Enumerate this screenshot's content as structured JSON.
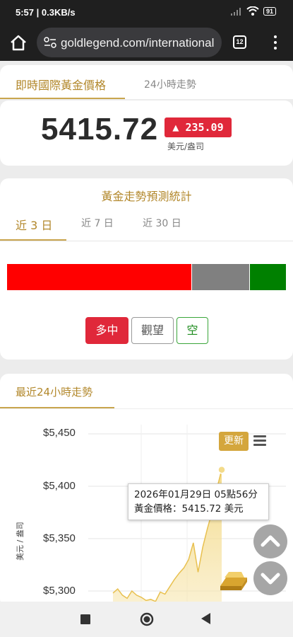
{
  "status": {
    "time": "5:57",
    "speed": "0.3KB/s",
    "battery": "91"
  },
  "browser": {
    "url": "goldlegend.com/international",
    "tab_count": "12"
  },
  "price_card": {
    "tab_live": "即時國際黃金價格",
    "tab_24h": "24小時走勢",
    "price": "5415.72",
    "change": "235.09",
    "change_direction": "up",
    "unit": "美元/盎司",
    "up_color": "#e0283a"
  },
  "forecast": {
    "title": "黃金走勢預測統計",
    "tabs": [
      "近 3 日",
      "近 7 日",
      "近 30 日"
    ],
    "active_tab": "近 3 日",
    "distribution": [
      {
        "label": "多中",
        "share": 0.66,
        "color": "#ff0000"
      },
      {
        "label": "觀望",
        "share": 0.205,
        "color": "#808080"
      },
      {
        "label": "空",
        "share": 0.135,
        "color": "#008000"
      }
    ],
    "buttons": {
      "bull": "多中",
      "neutral": "觀望",
      "bear": "空"
    }
  },
  "chart": {
    "title": "最近24小時走勢",
    "update_label": "更新",
    "tooltip_time": "2026年01月29日 05點56分",
    "tooltip_price": "黃金價格：5415.72 美元",
    "chart_data": {
      "type": "area",
      "ylabel": "美元 / 盎司",
      "yticks": [
        "$5,450",
        "$5,400",
        "$5,350",
        "$5,300"
      ],
      "ylim": [
        5290,
        5450
      ],
      "grid": true,
      "series": [
        {
          "values": [
            5298,
            5302,
            5296,
            5293,
            5300,
            5296,
            5294,
            5291,
            5292,
            5290,
            5299,
            5297,
            5304,
            5311,
            5317,
            5322,
            5330,
            5346,
            5318,
            5342,
            5360,
            5376,
            5398,
            5415.72
          ],
          "color": "#e8c04f"
        }
      ]
    }
  }
}
